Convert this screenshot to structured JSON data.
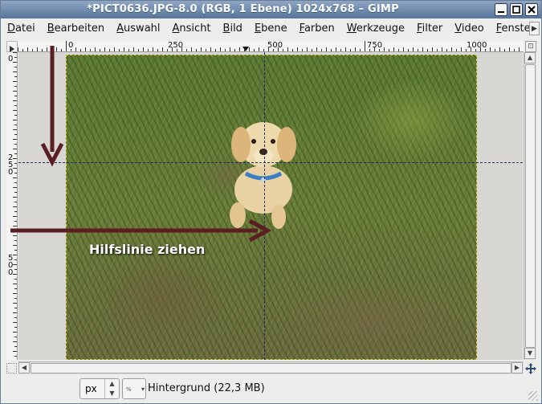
{
  "window": {
    "title": "*PICT0636.JPG-8.0 (RGB, 1 Ebene) 1024x768 – GIMP",
    "buttons": [
      "minimize",
      "maximize",
      "close"
    ]
  },
  "menubar": {
    "items": [
      "Datei",
      "Bearbeiten",
      "Auswahl",
      "Ansicht",
      "Bild",
      "Ebene",
      "Farben",
      "Werkzeuge",
      "Filter",
      "Video",
      "Fenster"
    ],
    "overflow_icon": "chevron-right-icon"
  },
  "rulers": {
    "horizontal_labels": [
      "0",
      "250",
      "500",
      "750",
      "1000"
    ],
    "vertical_labels": [
      "0",
      "250",
      "500"
    ]
  },
  "canvas": {
    "image_description_icon": "puppy-on-grass-photo",
    "annotation_text": "Hilfslinie ziehen",
    "guide_color": "#1b2c5c",
    "arrow_color": "#5a1e22"
  },
  "statusbar": {
    "unit": "px",
    "zoom": "%",
    "layer_info": "Hintergrund (22,3 MB)"
  }
}
